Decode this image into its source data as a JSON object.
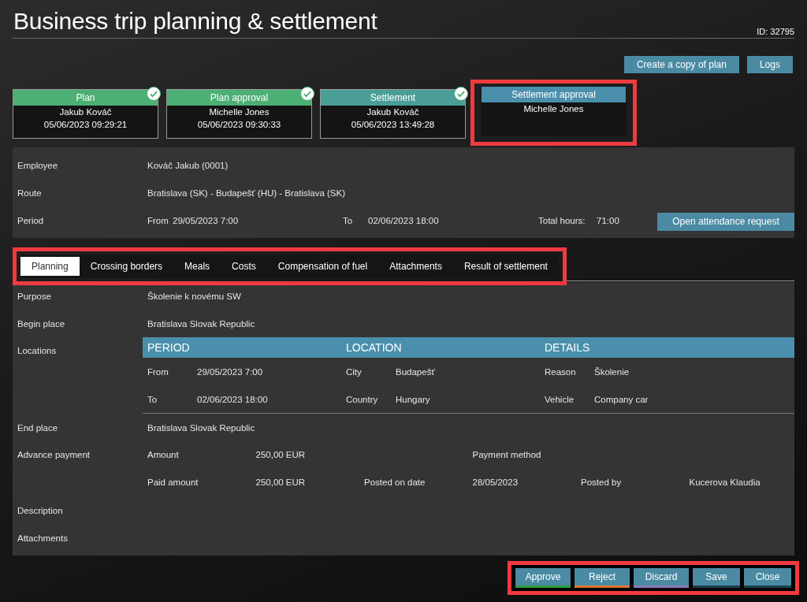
{
  "window": {
    "title": "Business trip planning & settlement",
    "id": "ID: 32795"
  },
  "toolbar": [
    {
      "label": "Create a copy of plan"
    },
    {
      "label": "Logs"
    }
  ],
  "steps": [
    {
      "title": "Plan",
      "person": "Jakub Kováč",
      "timestamp": "05/06/2023 09:29:21",
      "completed": true,
      "color": "#4caf73",
      "highlighted": false
    },
    {
      "title": "Plan approval",
      "person": "Michelle Jones",
      "timestamp": "05/06/2023 09:30:33",
      "completed": true,
      "color": "#4caf73",
      "highlighted": false
    },
    {
      "title": "Settlement",
      "person": "Jakub Kováč",
      "timestamp": "05/06/2023 13:49:28",
      "completed": true,
      "color": "#4a9e97",
      "highlighted": false
    },
    {
      "title": "Settlement approval",
      "person": "Michelle Jones",
      "completed": false,
      "color": "#4a8fac",
      "highlighted": true
    }
  ],
  "summary": [
    {
      "kind": "text",
      "label": "Employee",
      "value": "Kováč Jakub (0001)"
    },
    {
      "kind": "text",
      "label": "Route",
      "value": "Bratislava (SK) - Budapešť (HU) - Bratislava (SK)"
    },
    {
      "kind": "period",
      "label": "Period",
      "fields": [
        {
          "label": "From",
          "value": "29/05/2023 7:00"
        },
        {
          "label": "To",
          "value": "02/06/2023 18:00"
        },
        {
          "label": "Total hours:",
          "value": "71:00"
        }
      ],
      "button": "Open attendance request"
    }
  ],
  "tabs": {
    "highlighted": true,
    "items": [
      {
        "label": "Planning",
        "selected": true
      },
      {
        "label": "Crossing borders",
        "selected": false
      },
      {
        "label": "Meals",
        "selected": false
      },
      {
        "label": "Costs",
        "selected": false
      },
      {
        "label": "Compensation of fuel",
        "selected": false
      },
      {
        "label": "Attachments",
        "selected": false
      },
      {
        "label": "Result of settlement",
        "selected": false
      }
    ]
  },
  "planning": [
    {
      "kind": "text",
      "label": "Purpose",
      "value": "Školenie k novému SW"
    },
    {
      "kind": "text",
      "label": "Begin place",
      "value": "Bratislava Slovak Republic"
    },
    {
      "kind": "sections",
      "label": "Locations",
      "sections": [
        {
          "heading": "PERIOD",
          "fields": [
            {
              "label": "From",
              "value": "29/05/2023 7:00"
            },
            {
              "label": "To",
              "value": "02/06/2023 18:00"
            }
          ]
        },
        {
          "heading": "LOCATION",
          "fields": [
            {
              "label": "City",
              "value": "Budapešť"
            },
            {
              "label": "Country",
              "value": "Hungary"
            }
          ]
        },
        {
          "heading": "DETAILS",
          "fields": [
            {
              "label": "Reason",
              "value": "Školenie"
            },
            {
              "label": "Vehicle",
              "value": "Company car"
            }
          ]
        }
      ]
    },
    {
      "kind": "text",
      "label": "End place",
      "value": "Bratislava Slovak Republic"
    },
    {
      "kind": "grid",
      "label": "Advance payment",
      "lines": [
        [
          {
            "label": "Amount",
            "value": "250,00 EUR"
          },
          {
            "label": "Payment method"
          }
        ],
        [
          {
            "label": "Paid amount",
            "value": "250,00 EUR"
          },
          {
            "label": "Posted on date",
            "value": "28/05/2023"
          },
          {
            "label": "Posted by",
            "value": "Kucerova Klaudia"
          }
        ]
      ]
    },
    {
      "kind": "text",
      "label": "Description"
    },
    {
      "kind": "text",
      "label": "Attachments"
    }
  ],
  "actions": {
    "highlighted": true,
    "buttons": [
      {
        "label": "Approve",
        "color": "#2f9e3a"
      },
      {
        "label": "Reject",
        "color": "#e0752f"
      },
      {
        "label": "Discard",
        "color": "#8a7ab8"
      },
      {
        "label": "Save"
      },
      {
        "label": "Close"
      }
    ]
  }
}
